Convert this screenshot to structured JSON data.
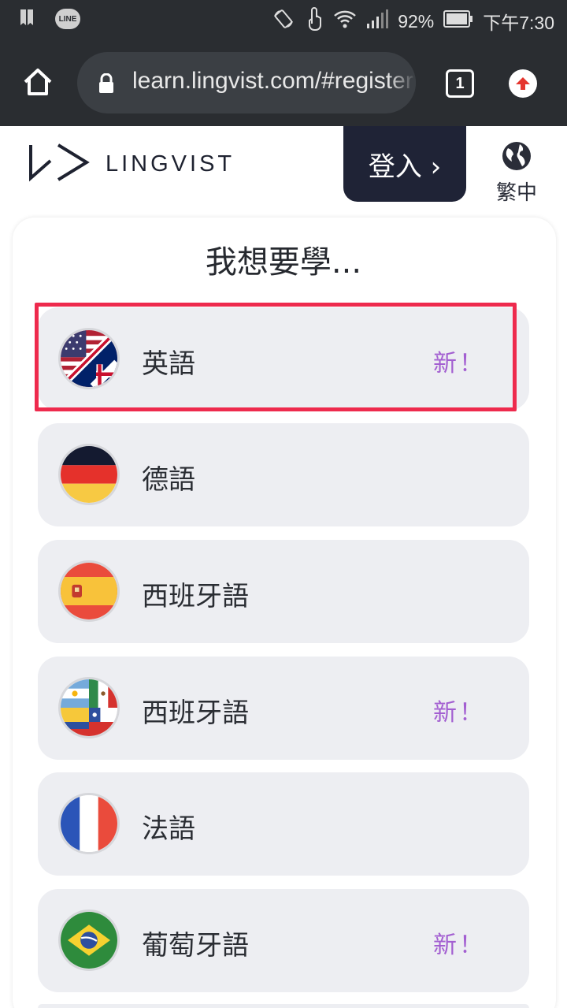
{
  "status_bar": {
    "line_label": "LINE",
    "battery": "92%",
    "time": "下午7:30"
  },
  "browser": {
    "url": "learn.lingvist.com/#register",
    "tab_count": "1"
  },
  "header": {
    "brand": "LINGVIST",
    "login_label": "登入 ›",
    "language_label": "繁中"
  },
  "main": {
    "title": "我想要學...",
    "courses": [
      {
        "name": "英語",
        "badge": "新！",
        "flag": "us-uk-flag-icon"
      },
      {
        "name": "德語",
        "badge": "",
        "flag": "germany-flag-icon"
      },
      {
        "name": "西班牙語",
        "badge": "",
        "flag": "spain-flag-icon"
      },
      {
        "name": "西班牙語",
        "badge": "新！",
        "flag": "latin-america-flags-icon"
      },
      {
        "name": "法語",
        "badge": "",
        "flag": "france-flag-icon"
      },
      {
        "name": "葡萄牙語",
        "badge": "新！",
        "flag": "brazil-flag-icon"
      }
    ]
  },
  "colors": {
    "bar": "#2a2d31",
    "badge": "#a35fd1",
    "highlight": "#ee2a4d",
    "item_bg": "#edeef2"
  }
}
